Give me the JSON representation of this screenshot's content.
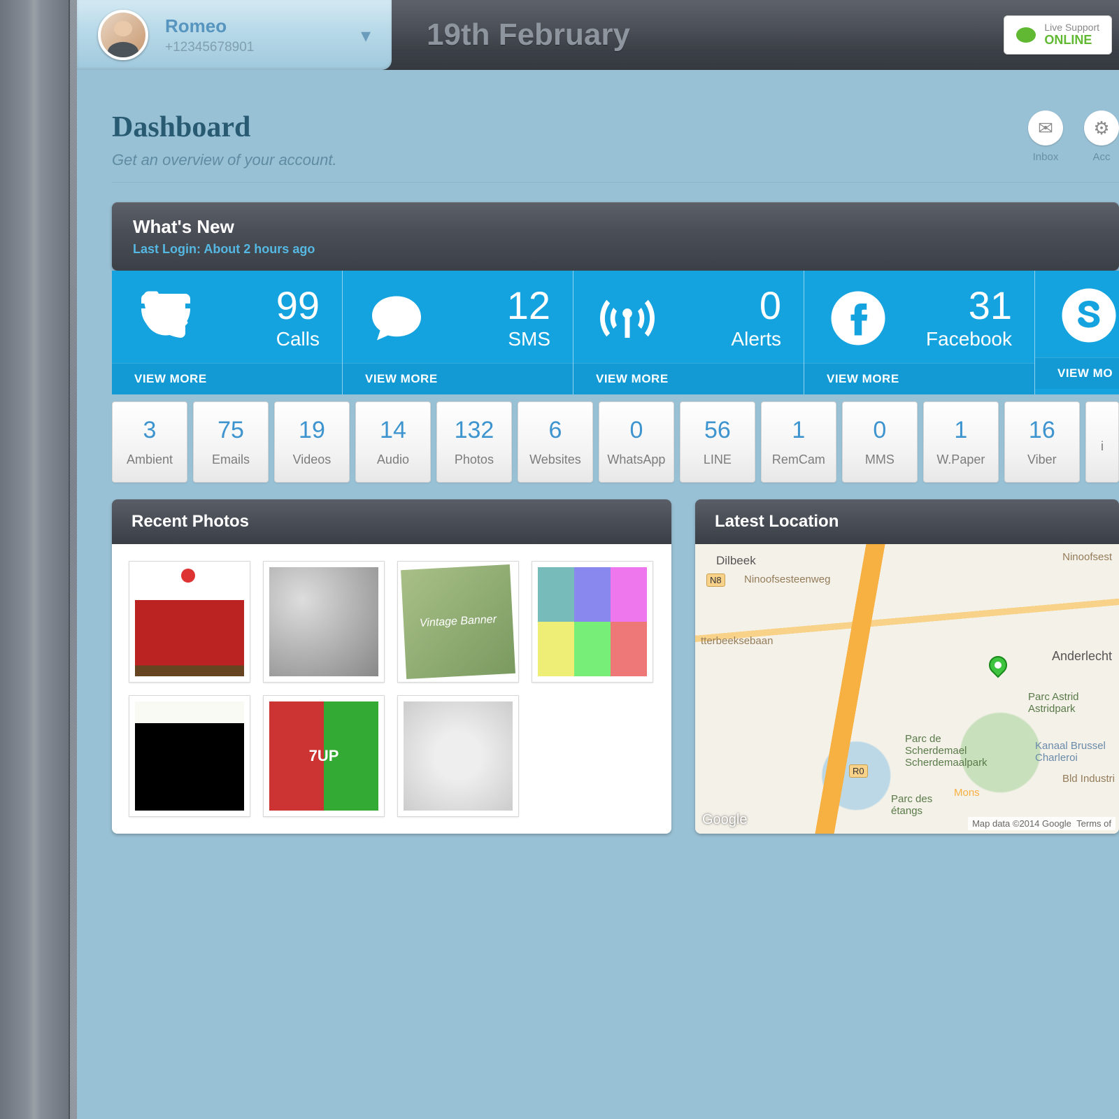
{
  "header": {
    "account_name": "Romeo",
    "account_phone": "+12345678901",
    "date": "19th February",
    "support_label": "Live Support",
    "support_status": "ONLINE"
  },
  "page": {
    "title": "Dashboard",
    "subtitle": "Get an overview of your account."
  },
  "action_icons": [
    {
      "label": "Inbox",
      "icon": "envelope"
    },
    {
      "label": "Acc",
      "icon": "gear"
    }
  ],
  "whats_new": {
    "title": "What's New",
    "last_login": "Last Login: About 2 hours ago"
  },
  "tiles": [
    {
      "icon": "phone",
      "count": "99",
      "label": "Calls",
      "link": "VIEW MORE"
    },
    {
      "icon": "chat",
      "count": "12",
      "label": "SMS",
      "link": "VIEW MORE"
    },
    {
      "icon": "antenna",
      "count": "0",
      "label": "Alerts",
      "link": "VIEW MORE"
    },
    {
      "icon": "facebook",
      "count": "31",
      "label": "Facebook",
      "link": "VIEW MORE"
    },
    {
      "icon": "skype",
      "count": "",
      "label": "",
      "link": "VIEW MO"
    }
  ],
  "mini": [
    {
      "count": "3",
      "label": "Ambient"
    },
    {
      "count": "75",
      "label": "Emails"
    },
    {
      "count": "19",
      "label": "Videos"
    },
    {
      "count": "14",
      "label": "Audio"
    },
    {
      "count": "132",
      "label": "Photos"
    },
    {
      "count": "6",
      "label": "Websites"
    },
    {
      "count": "0",
      "label": "WhatsApp"
    },
    {
      "count": "56",
      "label": "LINE"
    },
    {
      "count": "1",
      "label": "RemCam"
    },
    {
      "count": "0",
      "label": "MMS"
    },
    {
      "count": "1",
      "label": "W.Paper"
    },
    {
      "count": "16",
      "label": "Viber"
    },
    {
      "count": "",
      "label": "i"
    }
  ],
  "photos": {
    "title": "Recent Photos",
    "vintage_text": "Vintage Banner",
    "cans_text": "7UP"
  },
  "location": {
    "title": "Latest Location",
    "place1": "Dilbeek",
    "place2": "Anderlecht",
    "road1": "Ninoofsesteenweg",
    "road2": "tterbeeksebaan",
    "park1": "Parc de Scherdemael Scherdemaalpark",
    "park2": "Parc Astrid Astridpark",
    "park3": "Parc des étangs",
    "canal": "Kanaal Brussel Charleroi",
    "blvd": "Bld Industri",
    "ninoof": "Ninoofsest",
    "mons": "Mons",
    "n8": "N8",
    "r0": "R0",
    "logo": "Google",
    "attrib": "Map data ©2014 Google",
    "terms": "Terms of"
  }
}
